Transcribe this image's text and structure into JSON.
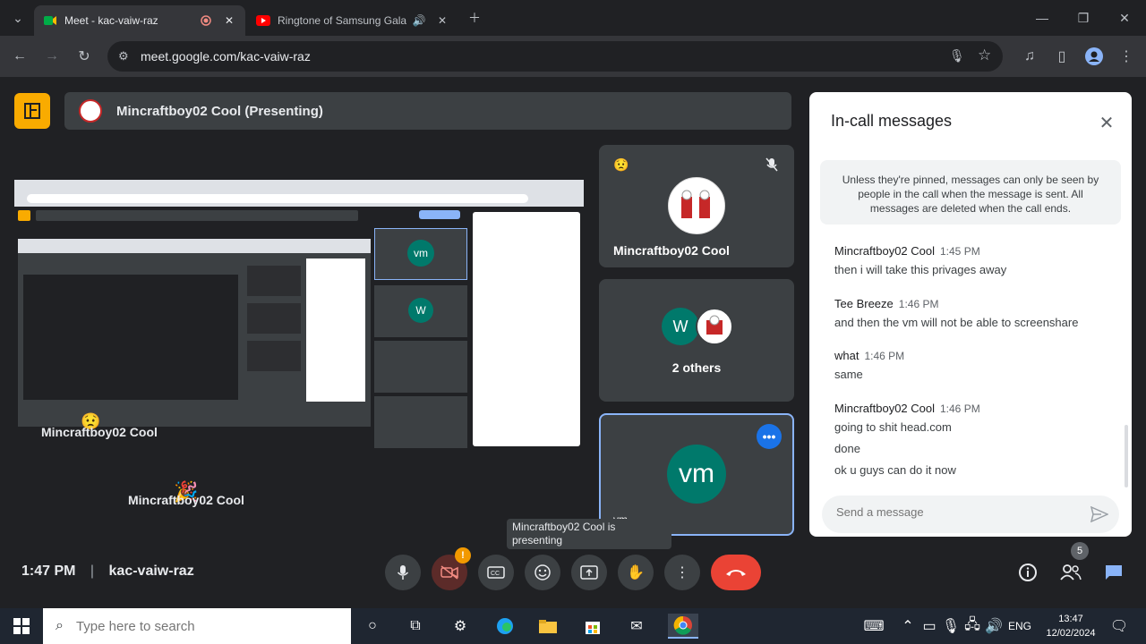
{
  "browser": {
    "tabs": [
      {
        "title": "Meet - kac-vaiw-raz",
        "active": true
      },
      {
        "title": "Ringtone of Samsung Galax",
        "active": false
      }
    ],
    "url": "meet.google.com/kac-vaiw-raz"
  },
  "meet": {
    "presenting_banner": "Mincraftboy02 Cool (Presenting)",
    "screenshare_labels": [
      "Mincraftboy02 Cool",
      "Mincraftboy02 Cool"
    ],
    "tiles": [
      {
        "name": "Mincraftboy02 Cool"
      },
      {
        "name": "2 others",
        "initial": "W"
      },
      {
        "name": "vm",
        "initial": "vm"
      }
    ],
    "tooltip": "Mincraftboy02 Cool is presenting",
    "time": "1:47 PM",
    "meeting_code": "kac-vaiw-raz",
    "people_count": "5"
  },
  "chat": {
    "title": "In-call messages",
    "note": "Unless they're pinned, messages can only be seen by people in the call when the message is sent. All messages are deleted when the call ends.",
    "messages": [
      {
        "sender": "Mincraftboy02 Cool",
        "time": "1:45 PM",
        "lines": [
          "then i will take this privages away"
        ]
      },
      {
        "sender": "Tee Breeze",
        "time": "1:46 PM",
        "lines": [
          "and then the vm will not be able to screenshare"
        ]
      },
      {
        "sender": "what",
        "time": "1:46 PM",
        "lines": [
          "same"
        ]
      },
      {
        "sender": "Mincraftboy02 Cool",
        "time": "1:46 PM",
        "lines": [
          "going to shit head.com",
          "done",
          "ok u guys can do it now"
        ]
      }
    ],
    "input_placeholder": "Send a message"
  },
  "taskbar": {
    "search_placeholder": "Type here to search",
    "lang": "ENG",
    "time": "13:47",
    "date": "12/02/2024"
  },
  "colors": {
    "meet_bg": "#202124",
    "tile_bg": "#3c4043",
    "hangup": "#ea4335",
    "accent_blue": "#8ab4f8",
    "teal_avatar": "#00796b"
  }
}
